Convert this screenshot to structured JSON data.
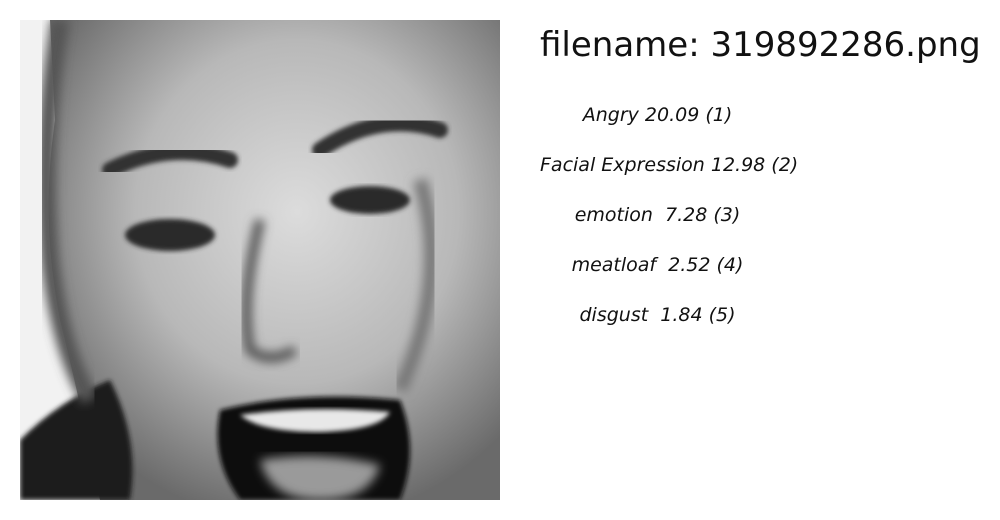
{
  "header": {
    "filename_text": "filename: 319892286.png"
  },
  "labels": [
    {
      "text": "Angry 20.09 (1)"
    },
    {
      "text": "Facial Expression 12.98 (2)"
    },
    {
      "text": "emotion  7.28 (3)"
    },
    {
      "text": "meatloaf  2.52 (4)"
    },
    {
      "text": "disgust  1.84 (5)"
    }
  ]
}
